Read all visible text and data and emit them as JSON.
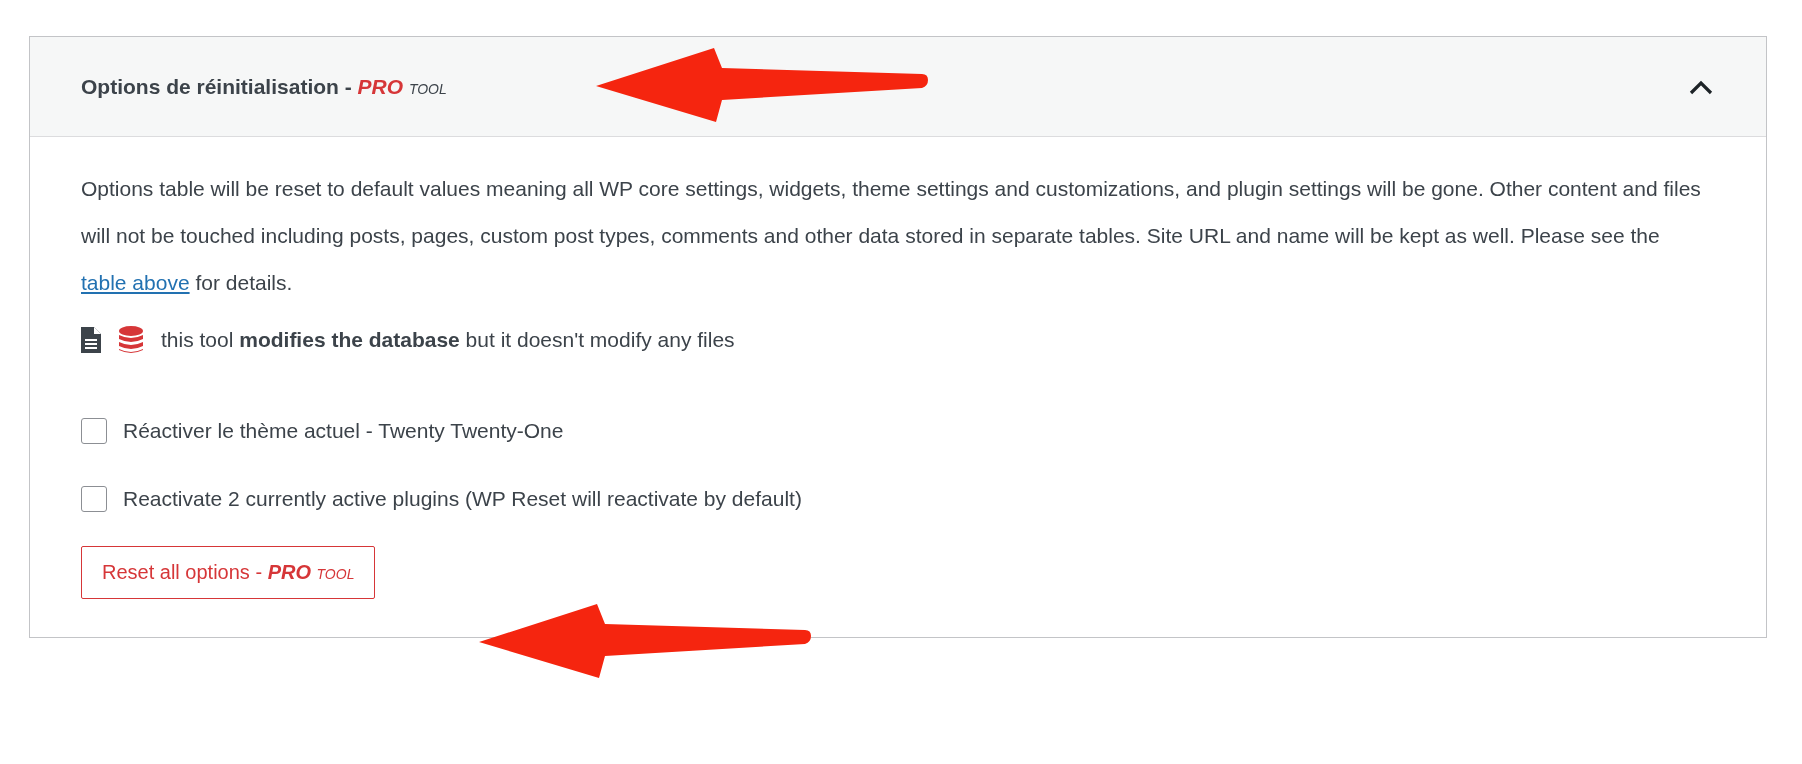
{
  "panel": {
    "title": "Options de réinitialisation - ",
    "pro_label": "PRO",
    "tool_label": "TOOL",
    "expanded": true
  },
  "description": {
    "before": "Options table will be reset to default values meaning all WP core settings, widgets, theme settings and customizations, and plugin settings will be gone. Other content and files will not be touched including posts, pages, custom post types, comments and other data stored in separate tables. Site URL and name will be kept as well. Please see the ",
    "link": "table above",
    "after": " for details."
  },
  "note": "this tool **modifies the database** but it doesn't modify any files",
  "options": [
    {
      "label": "Réactiver le thème actuel - Twenty Twenty-One",
      "checked": false
    },
    {
      "label": "Reactivate 2 currently active plugins (WP Reset will reactivate by default)",
      "checked": false
    }
  ],
  "button": {
    "label": "Reset all options - ",
    "pro_label": "PRO",
    "tool_label": "TOOL"
  }
}
